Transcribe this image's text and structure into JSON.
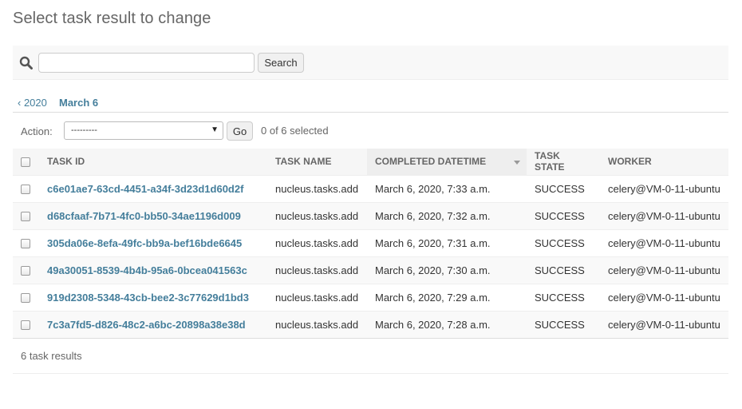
{
  "page": {
    "title": "Select task result to change"
  },
  "search": {
    "value": "",
    "placeholder": "",
    "button_label": "Search"
  },
  "date_hierarchy": {
    "back_label": "‹ 2020",
    "current_label": "March 6"
  },
  "actions": {
    "label": "Action:",
    "selected_option": "---------",
    "go_label": "Go",
    "counter": "0 of 6 selected"
  },
  "table": {
    "columns": [
      "Task ID",
      "Task name",
      "Completed datetime",
      "Task state",
      "Worker"
    ],
    "sorted_column": "Completed datetime",
    "rows": [
      {
        "task_id": "c6e01ae7-63cd-4451-a34f-3d23d1d60d2f",
        "task_name": "nucleus.tasks.add",
        "completed": "March 6, 2020, 7:33 a.m.",
        "state": "SUCCESS",
        "worker": "celery@VM-0-11-ubuntu"
      },
      {
        "task_id": "d68cfaaf-7b71-4fc0-bb50-34ae1196d009",
        "task_name": "nucleus.tasks.add",
        "completed": "March 6, 2020, 7:32 a.m.",
        "state": "SUCCESS",
        "worker": "celery@VM-0-11-ubuntu"
      },
      {
        "task_id": "305da06e-8efa-49fc-bb9a-bef16bde6645",
        "task_name": "nucleus.tasks.add",
        "completed": "March 6, 2020, 7:31 a.m.",
        "state": "SUCCESS",
        "worker": "celery@VM-0-11-ubuntu"
      },
      {
        "task_id": "49a30051-8539-4b4b-95a6-0bcea041563c",
        "task_name": "nucleus.tasks.add",
        "completed": "March 6, 2020, 7:30 a.m.",
        "state": "SUCCESS",
        "worker": "celery@VM-0-11-ubuntu"
      },
      {
        "task_id": "919d2308-5348-43cb-bee2-3c77629d1bd3",
        "task_name": "nucleus.tasks.add",
        "completed": "March 6, 2020, 7:29 a.m.",
        "state": "SUCCESS",
        "worker": "celery@VM-0-11-ubuntu"
      },
      {
        "task_id": "7c3a7fd5-d826-48c2-a6bc-20898a38e38d",
        "task_name": "nucleus.tasks.add",
        "completed": "March 6, 2020, 7:28 a.m.",
        "state": "SUCCESS",
        "worker": "celery@VM-0-11-ubuntu"
      }
    ]
  },
  "paginator": {
    "text": "6 task results"
  },
  "colors": {
    "link": "#447e9b",
    "title": "#666666",
    "toolbar_bg": "#f8f8f8"
  },
  "icons": {
    "search": "search-icon",
    "sort": "sort-descending-icon",
    "dropdown": "chevron-down-icon"
  }
}
